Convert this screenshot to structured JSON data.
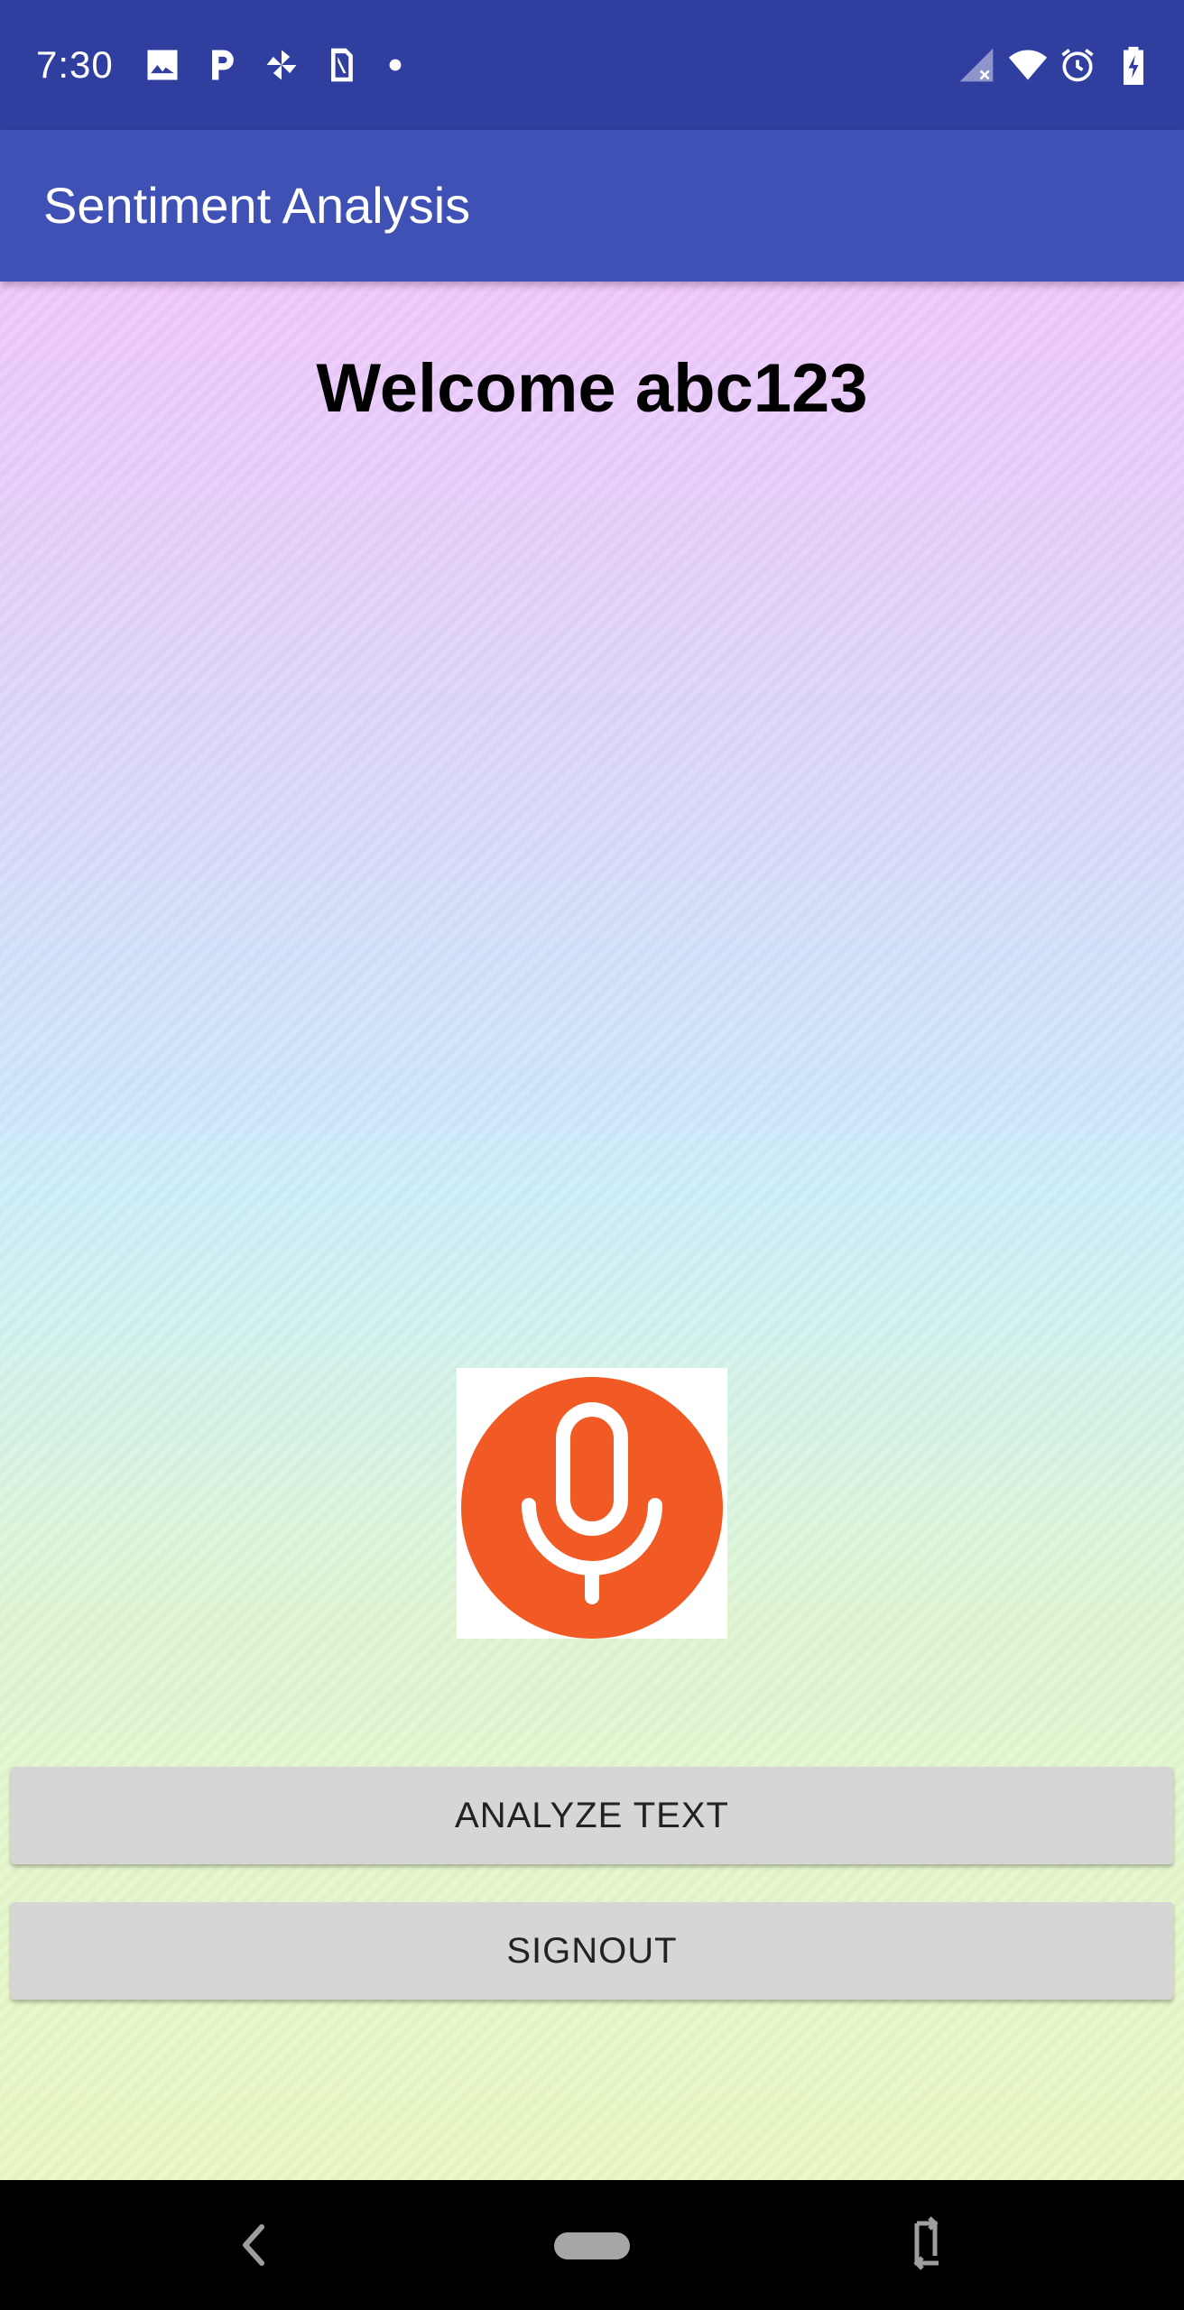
{
  "status_bar": {
    "time": "7:30",
    "left_icons": [
      "image-icon",
      "parking-icon",
      "pinwheel-icon",
      "sim-card-icon",
      "dot-icon"
    ],
    "right_icons": [
      "signal-no-sim-icon",
      "wifi-icon",
      "alarm-icon",
      "battery-charging-icon"
    ],
    "background": "#303f9f"
  },
  "app_bar": {
    "title": "Sentiment Analysis",
    "background": "#3f51b5"
  },
  "main": {
    "welcome_text": "Welcome abc123",
    "mic_icon": "microphone-icon",
    "mic_color": "#f15a24",
    "analyze_button_label": "ANALYZE TEXT",
    "signout_button_label": "SIGNOUT"
  },
  "nav_bar": {
    "icons": [
      "back-icon",
      "home-pill-icon",
      "rotate-icon"
    ]
  }
}
